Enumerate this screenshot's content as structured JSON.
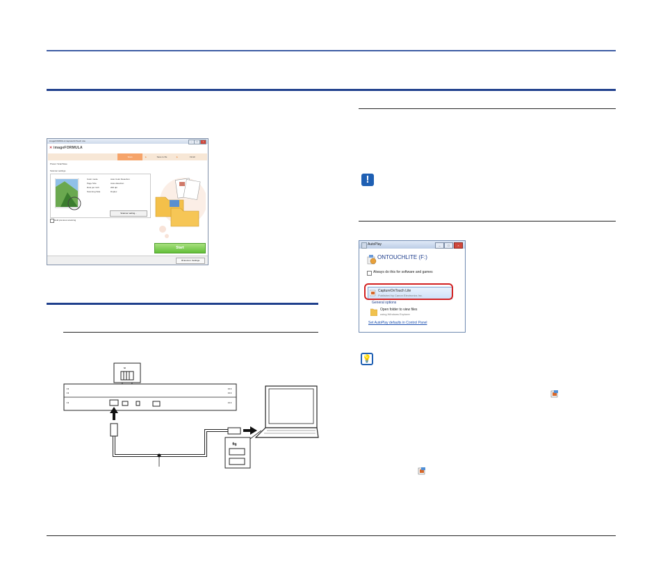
{
  "screenshot_window": {
    "title": "imageFORMULA CaptureOnTouch Lite",
    "logo": "imageFORMULA",
    "steps": [
      "Scan",
      "Save to file",
      "Finish"
    ],
    "preset": "Preset: Scan/Save",
    "section": "Scanner settings",
    "settings": [
      {
        "label": "Color mode",
        "value": "Auto Color Detection"
      },
      {
        "label": "Page Size",
        "value": "Auto-detection"
      },
      {
        "label": "Dots per inch",
        "value": "200 dpi"
      },
      {
        "label": "Scanning Side",
        "value": "Duplex"
      }
    ],
    "settings_button": "Scanner setting...",
    "checkbox_label": "Hold previous scanning",
    "start_button": "Start",
    "env_button": "Environ. Settings"
  },
  "autoplay": {
    "title": "AutoPlay",
    "drive": "ONTOUCHLITE (F:)",
    "always_checkbox": "Always do this for software and games",
    "option_title": "CaptureOnTouch Lite",
    "option_sub": "Published by Canon Electronics Inc.",
    "general_options": "General options",
    "open_folder": "Open folder to view files",
    "open_folder_sub": "using Windows Explorer",
    "defaults_link": "Set AutoPlay defaults in Control Panel"
  },
  "colors": {
    "rule": "#1f3f8c",
    "highlight": "#d22020",
    "start": "#63bf3a"
  }
}
